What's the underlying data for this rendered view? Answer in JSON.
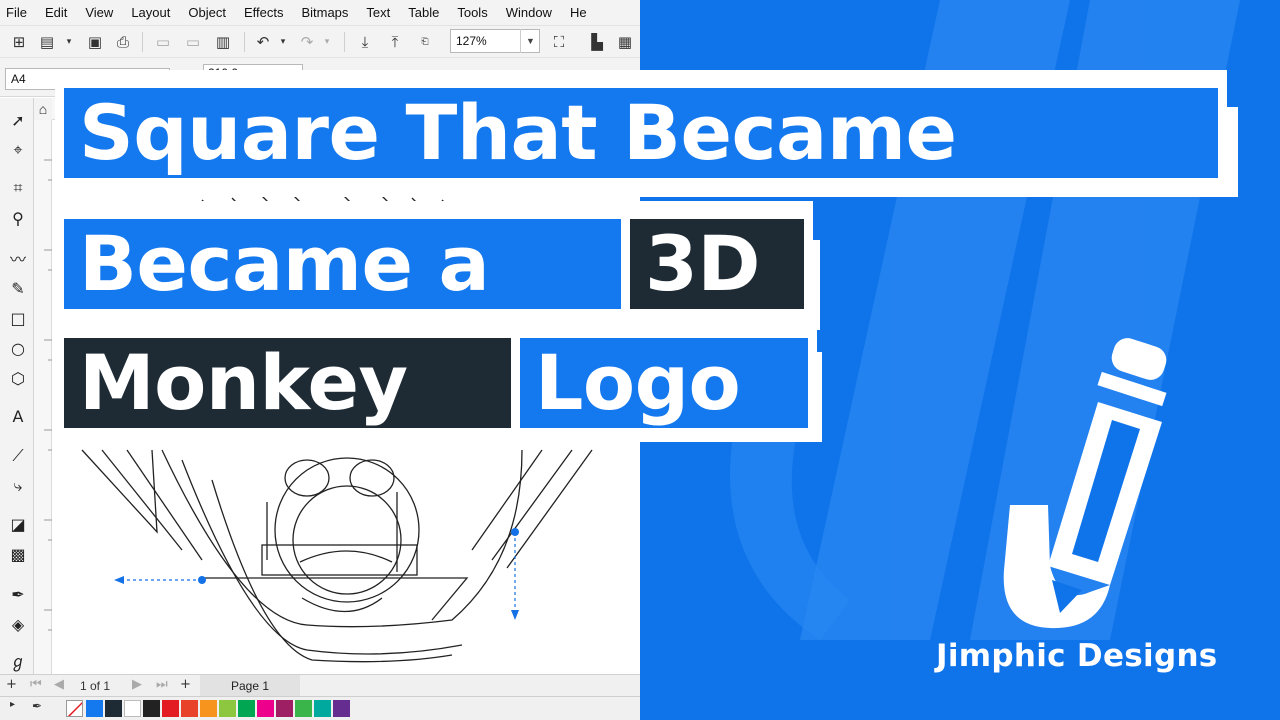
{
  "menubar": {
    "items": [
      "File",
      "Edit",
      "View",
      "Layout",
      "Object",
      "Effects",
      "Bitmaps",
      "Text",
      "Table",
      "Tools",
      "Window",
      "He"
    ]
  },
  "toolbar": {
    "zoom_value": "127%",
    "paper_size": "A4",
    "page_width": "210.0 mm"
  },
  "pagebar": {
    "page_count": "1 of 1",
    "page_tab": "Page 1"
  },
  "palette": {
    "swatches": [
      "#1478ee",
      "#1e2b35",
      "#ffffff",
      "#222222",
      "#e31b23",
      "#e8432a",
      "#f7941d",
      "#8dc63f",
      "#00a651",
      "#ec008c",
      "#9e1f63",
      "#39b54a",
      "#00a99d",
      "#662d91"
    ]
  },
  "headline": {
    "line1": "Square That Became",
    "line2_word1": "Became a",
    "line2_word2": "3D",
    "line3_word1": "Monkey",
    "line3_word2": "Logo"
  },
  "brand": {
    "name": "Jimphic Designs",
    "color": "#0f73ea",
    "accent_dark": "#1e2b35"
  },
  "icons": {
    "logo": "jimphic-pencil-j-logo-icon"
  }
}
